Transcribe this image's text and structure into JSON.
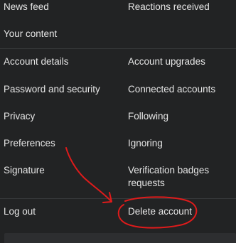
{
  "menu": {
    "news_feed": "News feed",
    "reactions_received": "Reactions received",
    "your_content": "Your content",
    "account_details": "Account details",
    "account_upgrades": "Account upgrades",
    "password_security": "Password and security",
    "connected_accounts": "Connected accounts",
    "privacy": "Privacy",
    "following": "Following",
    "preferences": "Preferences",
    "ignoring": "Ignoring",
    "signature": "Signature",
    "verification_badges": "Verification badges requests",
    "log_out": "Log out",
    "delete_account": "Delete account"
  },
  "colors": {
    "background": "#222324",
    "text": "#e6e6e6",
    "divider": "#37393b",
    "annotation": "#e01b1b"
  }
}
